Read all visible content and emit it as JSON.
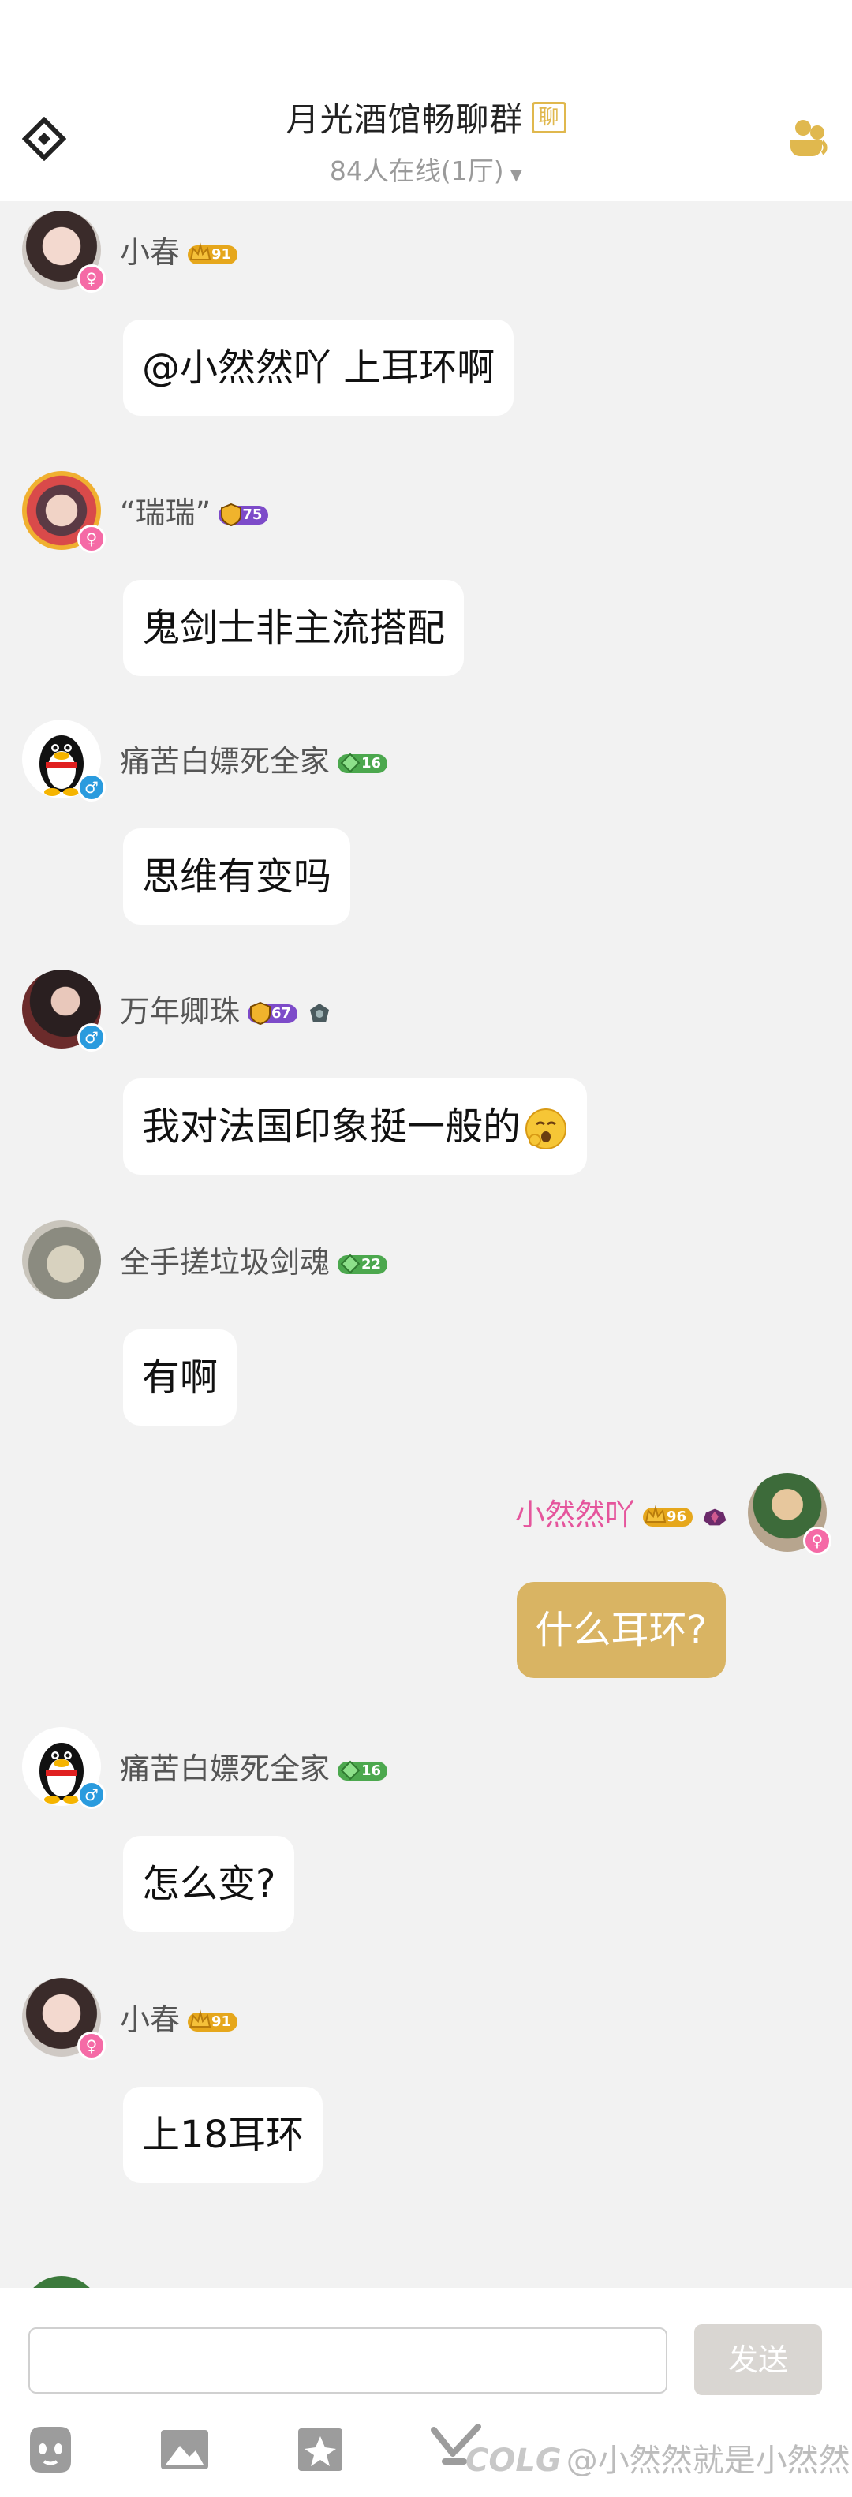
{
  "header": {
    "title": "月光酒馆畅聊群",
    "tag": "聊",
    "subtitle": "84人在线(1厅)"
  },
  "messages": [
    {
      "name": "小春",
      "level": "91",
      "badge_color": "gold",
      "sex": "female",
      "text": "@小然然吖 上耳环啊",
      "mine": false
    },
    {
      "name": "“瑞瑞”",
      "level": "75",
      "badge_color": "purple",
      "sex": "female",
      "text": "鬼剑士非主流搭配",
      "mine": false
    },
    {
      "name": "痛苦白嫖死全家",
      "level": "16",
      "badge_color": "green",
      "sex": "male",
      "text": "思维有变吗",
      "mine": false
    },
    {
      "name": "万年卿珠",
      "level": "67",
      "badge_color": "purple",
      "sex": "male",
      "text": "我对法国印象挺一般的",
      "mine": false
    },
    {
      "name": "全手搓垃圾剑魂",
      "level": "22",
      "badge_color": "green",
      "sex": "none",
      "text": "有啊",
      "mine": false
    },
    {
      "name": "小然然吖",
      "level": "96",
      "badge_color": "gold",
      "sex": "female",
      "text": "什么耳环?",
      "mine": true
    },
    {
      "name": "痛苦白嫖死全家",
      "level": "16",
      "badge_color": "green",
      "sex": "male",
      "text": "怎么变?",
      "mine": false
    },
    {
      "name": "小春",
      "level": "91",
      "badge_color": "gold",
      "sex": "female",
      "text": "上18耳环",
      "mine": false
    }
  ],
  "input": {
    "placeholder": "",
    "send_label": "发送"
  },
  "toolbar": {
    "icons": [
      "emoji-icon",
      "image-icon",
      "photo-icon",
      "game-icon"
    ]
  },
  "watermark": {
    "logo": "COLG",
    "text": "@小然然就是小然然"
  },
  "colors": {
    "accent": "#d9b463",
    "my_name": "#e5559c",
    "background": "#f2f2f2"
  }
}
